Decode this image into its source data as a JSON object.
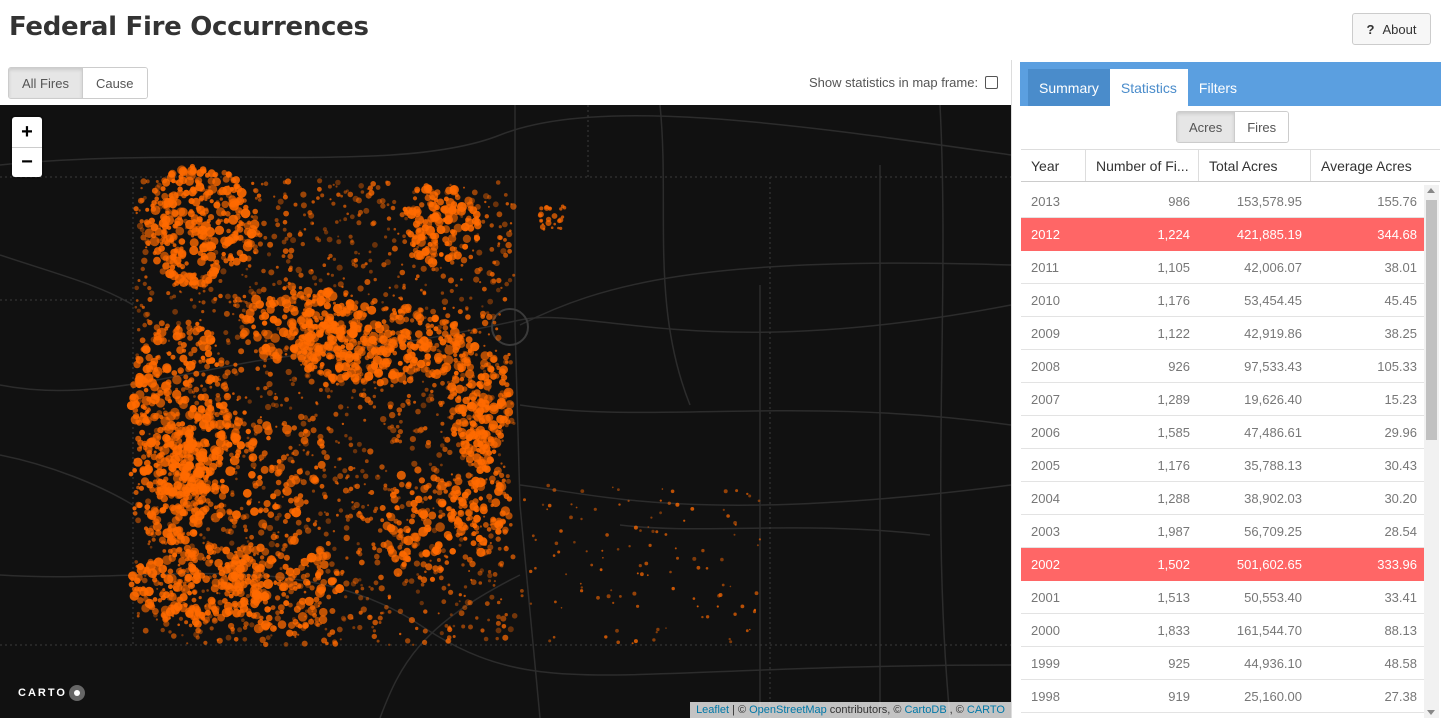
{
  "app": {
    "title": "Federal Fire Occurrences",
    "about_label": "About",
    "about_icon": "question-icon"
  },
  "map_controls": {
    "modes": [
      "All Fires",
      "Cause"
    ],
    "active_mode": "All Fires",
    "stats_toggle_label": "Show statistics in map frame:",
    "stats_toggle_checked": false,
    "zoom_in": "+",
    "zoom_out": "−",
    "logo": "CARTO",
    "fire_color": "#ff6a00"
  },
  "attribution": {
    "leaflet": "Leaflet",
    "sep1": "| ©",
    "osm": "OpenStreetMap",
    "contrib": "contributors, ©",
    "cartodb": "CartoDB",
    "sep2": ", ©",
    "carto": "CARTO"
  },
  "panel": {
    "tabs": [
      "Summary",
      "Statistics",
      "Filters"
    ],
    "active_tab": "Statistics",
    "units": [
      "Acres",
      "Fires"
    ],
    "active_unit": "Acres",
    "columns": [
      "Year",
      "Number of Fi...",
      "Total Acres",
      "Average Acres"
    ],
    "highlight_color": "#ff6666",
    "rows": [
      {
        "year": "2013",
        "fires": "986",
        "total": "153,578.95",
        "avg": "155.76",
        "hl": false
      },
      {
        "year": "2012",
        "fires": "1,224",
        "total": "421,885.19",
        "avg": "344.68",
        "hl": true
      },
      {
        "year": "2011",
        "fires": "1,105",
        "total": "42,006.07",
        "avg": "38.01",
        "hl": false
      },
      {
        "year": "2010",
        "fires": "1,176",
        "total": "53,454.45",
        "avg": "45.45",
        "hl": false
      },
      {
        "year": "2009",
        "fires": "1,122",
        "total": "42,919.86",
        "avg": "38.25",
        "hl": false
      },
      {
        "year": "2008",
        "fires": "926",
        "total": "97,533.43",
        "avg": "105.33",
        "hl": false
      },
      {
        "year": "2007",
        "fires": "1,289",
        "total": "19,626.40",
        "avg": "15.23",
        "hl": false
      },
      {
        "year": "2006",
        "fires": "1,585",
        "total": "47,486.61",
        "avg": "29.96",
        "hl": false
      },
      {
        "year": "2005",
        "fires": "1,176",
        "total": "35,788.13",
        "avg": "30.43",
        "hl": false
      },
      {
        "year": "2004",
        "fires": "1,288",
        "total": "38,902.03",
        "avg": "30.20",
        "hl": false
      },
      {
        "year": "2003",
        "fires": "1,987",
        "total": "56,709.25",
        "avg": "28.54",
        "hl": false
      },
      {
        "year": "2002",
        "fires": "1,502",
        "total": "501,602.65",
        "avg": "333.96",
        "hl": true
      },
      {
        "year": "2001",
        "fires": "1,513",
        "total": "50,553.40",
        "avg": "33.41",
        "hl": false
      },
      {
        "year": "2000",
        "fires": "1,833",
        "total": "161,544.70",
        "avg": "88.13",
        "hl": false
      },
      {
        "year": "1999",
        "fires": "925",
        "total": "44,936.10",
        "avg": "48.58",
        "hl": false
      },
      {
        "year": "1998",
        "fires": "919",
        "total": "25,160.00",
        "avg": "27.38",
        "hl": false
      }
    ]
  }
}
